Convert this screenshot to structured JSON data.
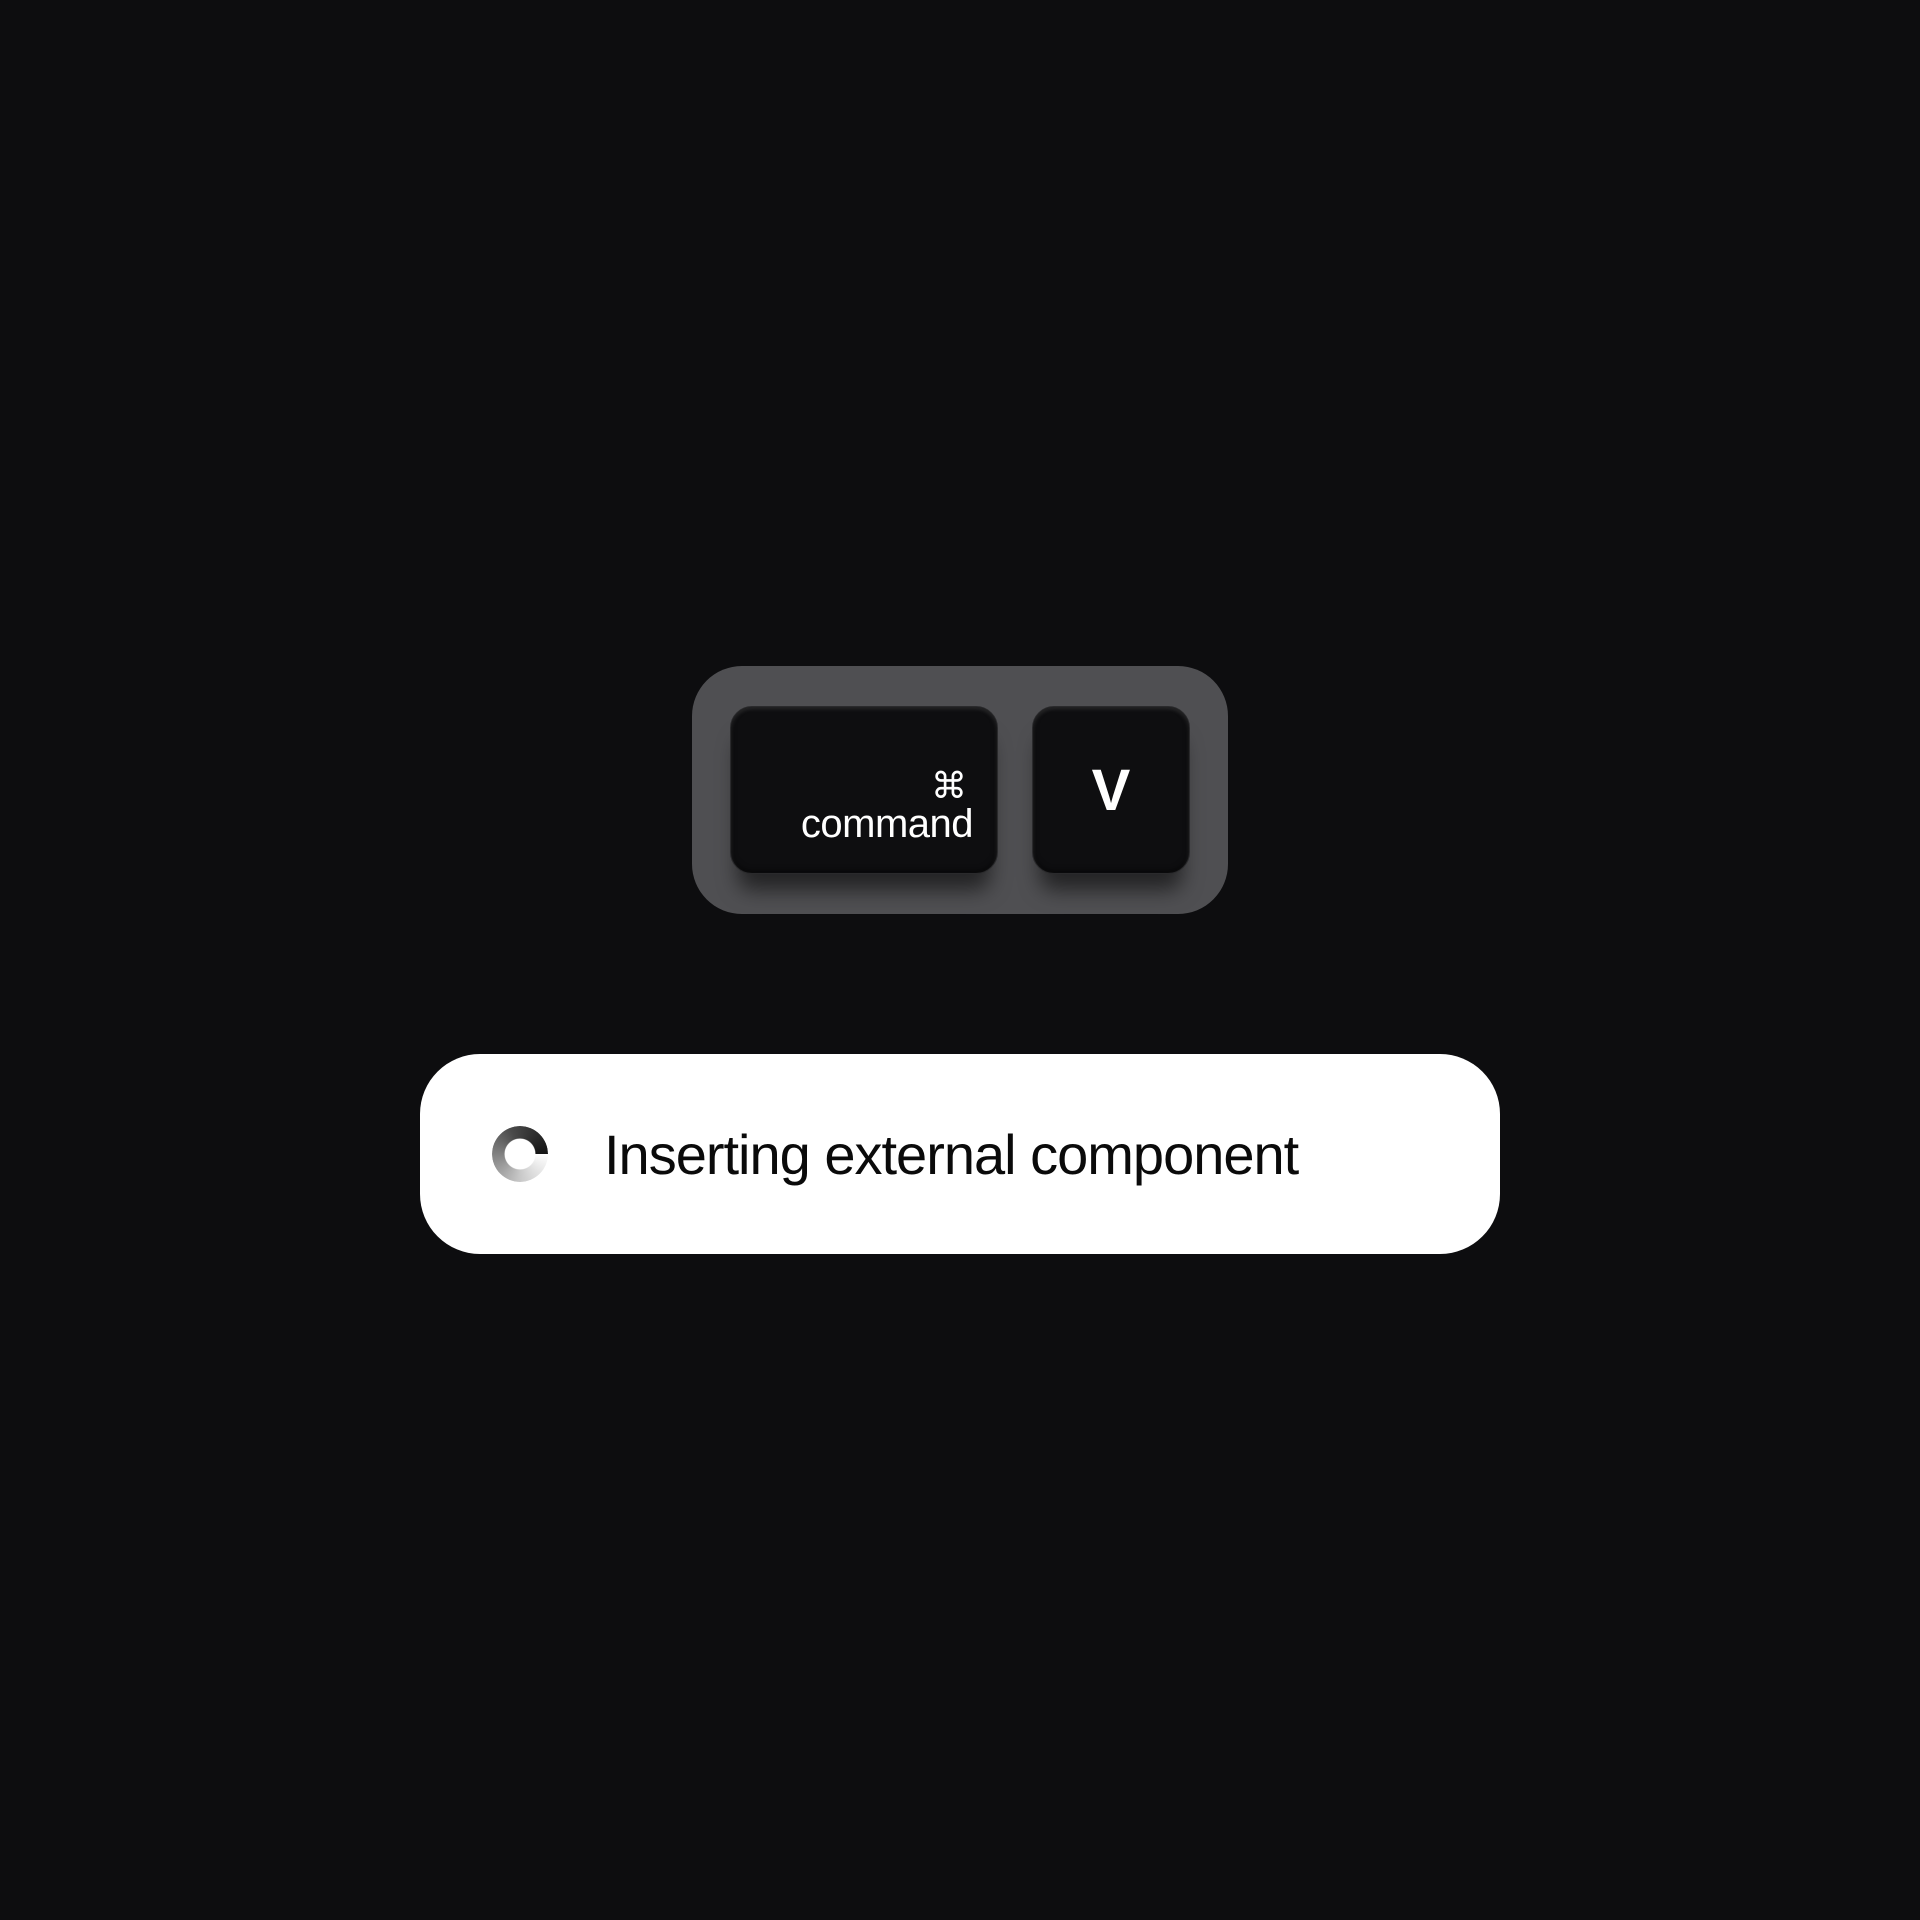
{
  "shortcut": {
    "modifier_icon": "⌘",
    "modifier_label": "command",
    "key_label": "V"
  },
  "toast": {
    "message": "Inserting external component"
  }
}
